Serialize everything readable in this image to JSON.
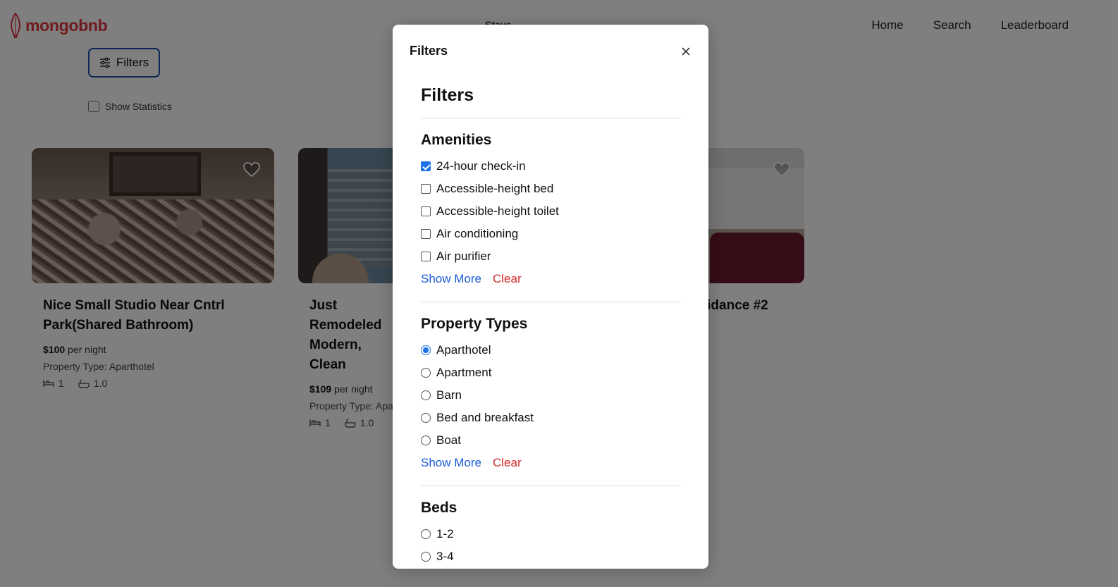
{
  "header": {
    "brand": "mongobnb",
    "stays_label": "Stays",
    "nav": [
      "Home",
      "Search",
      "Leaderboard"
    ]
  },
  "toolbar": {
    "filters_label": "Filters",
    "show_statistics_label": "Show Statistics"
  },
  "listings": [
    {
      "title": "Nice Small Studio Near Cntrl Park(Shared Bathroom)",
      "price": "$100",
      "price_suffix": "per night",
      "property_type": "Property Type: Aparthotel",
      "beds": "1",
      "baths": "1.0"
    },
    {
      "title": "Just Remodeled Modern, Clean",
      "price": "$109",
      "price_suffix": "per night",
      "property_type": "Property Type: Apa",
      "beds": "1",
      "baths": "1.0"
    },
    {
      "title": "esidance #2"
    }
  ],
  "modal": {
    "header_title": "Filters",
    "body_title": "Filters",
    "amenities": {
      "title": "Amenities",
      "options": [
        {
          "label": "24-hour check-in",
          "checked": true
        },
        {
          "label": "Accessible-height bed",
          "checked": false
        },
        {
          "label": "Accessible-height toilet",
          "checked": false
        },
        {
          "label": "Air conditioning",
          "checked": false
        },
        {
          "label": "Air purifier",
          "checked": false
        }
      ],
      "show_more": "Show More",
      "clear": "Clear"
    },
    "property_types": {
      "title": "Property Types",
      "options": [
        {
          "label": "Aparthotel",
          "selected": true
        },
        {
          "label": "Apartment",
          "selected": false
        },
        {
          "label": "Barn",
          "selected": false
        },
        {
          "label": "Bed and breakfast",
          "selected": false
        },
        {
          "label": "Boat",
          "selected": false
        }
      ],
      "show_more": "Show More",
      "clear": "Clear"
    },
    "beds": {
      "title": "Beds",
      "options": [
        {
          "label": "1-2",
          "selected": false
        },
        {
          "label": "3-4",
          "selected": false
        }
      ]
    }
  },
  "colors": {
    "brand": "#e0363f",
    "accent": "#1a73e8",
    "link": "#1a5ad8",
    "clear": "#d42a2a",
    "filters_border": "#1f4ea8"
  },
  "icons": [
    "mongodb-leaf-icon",
    "sliders-icon",
    "heart-icon",
    "bed-icon",
    "bath-icon",
    "close-icon"
  ]
}
